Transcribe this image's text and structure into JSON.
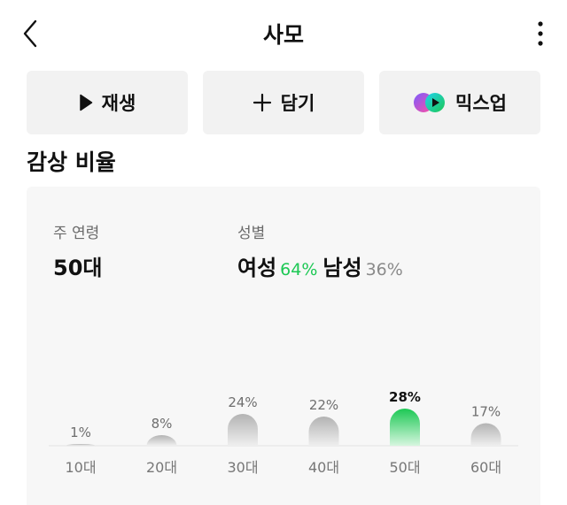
{
  "header": {
    "title": "사모",
    "back_icon": "chevron-left-icon",
    "more_icon": "more-vertical-icon"
  },
  "actions": [
    {
      "label": "재생",
      "icon": "play-icon"
    },
    {
      "label": "담기",
      "icon": "plus-icon"
    },
    {
      "label": "믹스업",
      "icon": "mixup-icon"
    }
  ],
  "section_title": "감상 비율",
  "stats": {
    "age_label": "주 연령",
    "age_value": "50대",
    "gender_label": "성별",
    "female_label": "여성",
    "female_pct": "64%",
    "male_label": "남성",
    "male_pct": "36%"
  },
  "colors": {
    "accent": "#1cc854",
    "card_bg": "#f7f7f7",
    "button_bg": "#f2f2f2"
  },
  "chart_data": {
    "type": "bar",
    "categories": [
      "10대",
      "20대",
      "30대",
      "40대",
      "50대",
      "60대"
    ],
    "values": [
      1,
      8,
      24,
      22,
      28,
      17
    ],
    "value_labels": [
      "1%",
      "8%",
      "24%",
      "22%",
      "28%",
      "17%"
    ],
    "highlight": "50대"
  }
}
